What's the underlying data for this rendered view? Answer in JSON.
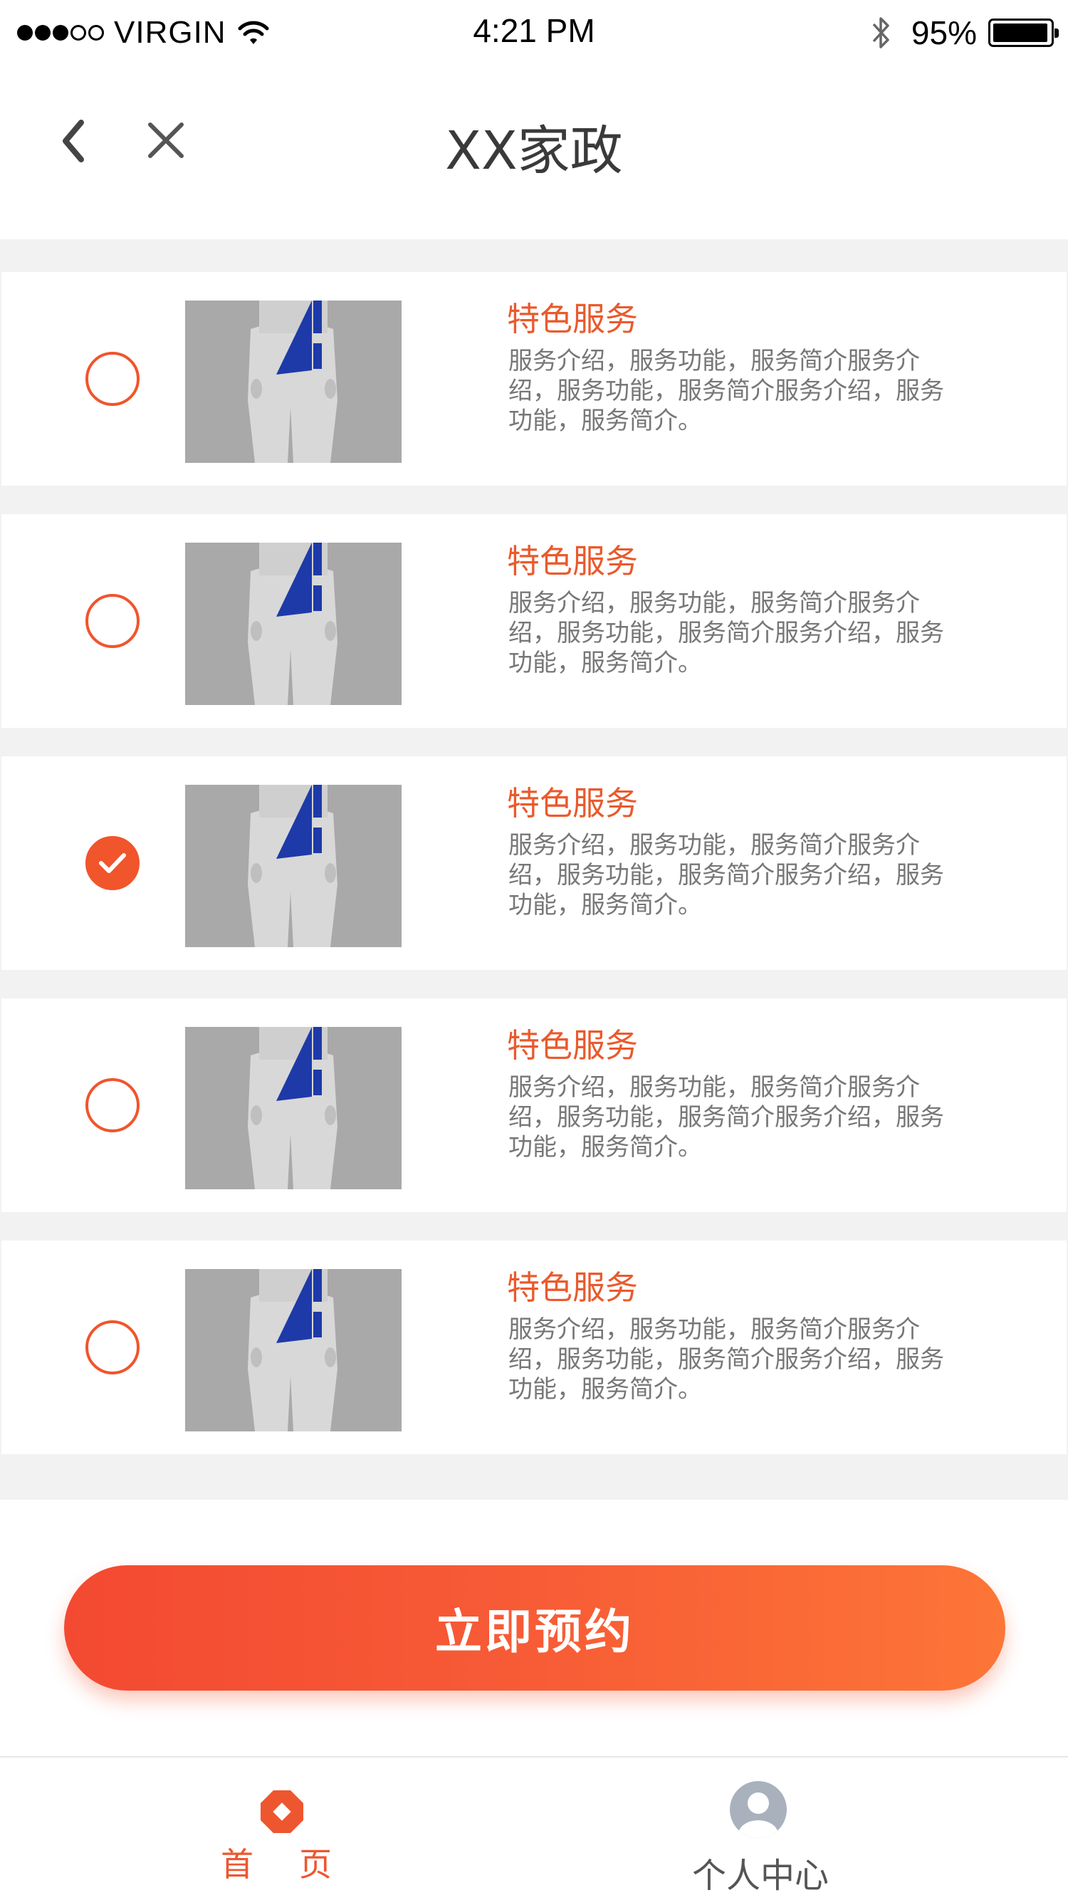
{
  "status_bar": {
    "carrier": "VIRGIN",
    "time": "4:21 PM",
    "battery": "95%",
    "battery_level": 0.95,
    "signal_bars_filled": 3,
    "signal_bars_total": 5
  },
  "nav": {
    "title": "XX家政",
    "back_icon": "chevron-left-icon",
    "close_icon": "close-icon"
  },
  "services": [
    {
      "title": "特色服务",
      "description": "服务介绍，服务功能，服务简介服务介绍，服务功能，服务简介服务介绍，服务功能，服务简介。",
      "selected": false
    },
    {
      "title": "特色服务",
      "description": "服务介绍，服务功能，服务简介服务介绍，服务功能，服务简介服务介绍，服务功能，服务简介。",
      "selected": false
    },
    {
      "title": "特色服务",
      "description": "服务介绍，服务功能，服务简介服务介绍，服务功能，服务简介服务介绍，服务功能，服务简介。",
      "selected": true
    },
    {
      "title": "特色服务",
      "description": "服务介绍，服务功能，服务简介服务介绍，服务功能，服务简介服务介绍，服务功能，服务简介。",
      "selected": false
    },
    {
      "title": "特色服务",
      "description": "服务介绍，服务功能，服务简介服务介绍，服务功能，服务简介服务介绍，服务功能，服务简介。",
      "selected": false
    }
  ],
  "cta": {
    "label": "立即预约"
  },
  "tabs": [
    {
      "label": "首页",
      "icon": "home-icon",
      "active": true
    },
    {
      "label": "个人中心",
      "icon": "user-icon",
      "active": false
    }
  ],
  "colors": {
    "accent": "#f0552c",
    "gradient_start": "#f34932",
    "gradient_end": "#fd7537",
    "background": "#f2f2f2"
  }
}
